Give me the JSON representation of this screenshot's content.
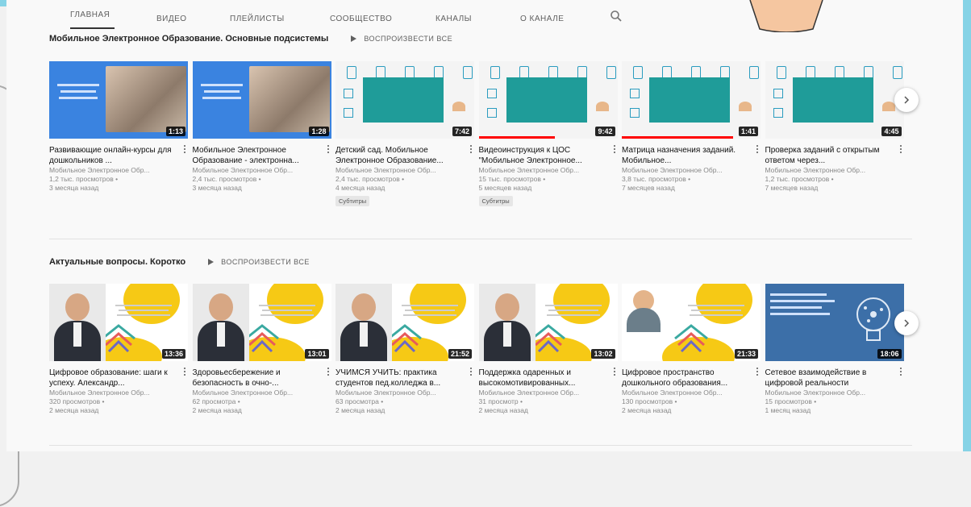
{
  "nav": {
    "tabs": [
      "ГЛАВНАЯ",
      "ВИДЕО",
      "ПЛЕЙЛИСТЫ",
      "СООБЩЕСТВО",
      "КАНАЛЫ",
      "О КАНАЛЕ"
    ],
    "active": "ГЛАВНАЯ"
  },
  "sections": [
    {
      "title": "Мобильное Электронное Образование. Основные подсистемы",
      "play_all": "ВОСПРОИЗВЕСТИ ВСЕ",
      "videos": [
        {
          "title": "Развивающие онлайн-курсы для дошкольников ...",
          "channel": "Мобильное Электронное Обр...",
          "views": "1,2 тыс. просмотров",
          "age": "3 месяца назад",
          "duration": "1:13",
          "thumb": "blue-photo"
        },
        {
          "title": "Мобильное Электронное Образование - электронна...",
          "channel": "Мобильное Электронное Обр...",
          "views": "2,4 тыс. просмотров",
          "age": "3 месяца назад",
          "duration": "1:28",
          "thumb": "blue-photo"
        },
        {
          "title": "Детский сад. Мобильное Электронное Образование...",
          "channel": "Мобильное Электронное Обр...",
          "views": "2,4 тыс. просмотров",
          "age": "4 месяца назад",
          "duration": "7:42",
          "badge": "Субтитры",
          "thumb": "teal"
        },
        {
          "title": "Видеоинструкция к ЦОС \"Мобильное Электронное...",
          "channel": "Мобильное Электронное Обр...",
          "views": "15 тыс. просмотров",
          "age": "5 месяцев назад",
          "duration": "9:42",
          "badge": "Субтитры",
          "progress": 0.55,
          "thumb": "teal"
        },
        {
          "title": "Матрица назначения заданий. Мобильное...",
          "channel": "Мобильное Электронное Обр...",
          "views": "3,8 тыс. просмотров",
          "age": "7 месяцев назад",
          "duration": "1:41",
          "progress": 0.8,
          "thumb": "teal"
        },
        {
          "title": "Проверка заданий с открытым ответом через...",
          "channel": "Мобильное Электронное Обр...",
          "views": "1,2 тыс. просмотров",
          "age": "7 месяцев назад",
          "duration": "4:45",
          "thumb": "teal"
        }
      ]
    },
    {
      "title": "Актуальные вопросы. Коротко",
      "play_all": "ВОСПРОИЗВЕСТИ ВСЕ",
      "videos": [
        {
          "title": "Цифровое образование: шаги к успеху. Александр...",
          "channel": "Мобильное Электронное Обр...",
          "views": "320 просмотров",
          "age": "2 месяца назад",
          "duration": "13:36",
          "thumb": "person"
        },
        {
          "title": "Здоровьесбережение и безопасность в очно-...",
          "channel": "Мобильное Электронное Обр...",
          "views": "62 просмотра",
          "age": "2 месяца назад",
          "duration": "13:01",
          "thumb": "person"
        },
        {
          "title": "УЧИМСЯ УЧИТЬ: практика студентов пед.колледжа в...",
          "channel": "Мобильное Электронное Обр...",
          "views": "63 просмотра",
          "age": "2 месяца назад",
          "duration": "21:52",
          "thumb": "person"
        },
        {
          "title": "Поддержка одаренных и высокомотивированных...",
          "channel": "Мобильное Электронное Обр...",
          "views": "31 просмотр",
          "age": "2 месяца назад",
          "duration": "13:02",
          "thumb": "person"
        },
        {
          "title": "Цифровое пространство дошкольного образования...",
          "channel": "Мобильное Электронное Обр...",
          "views": "130 просмотров",
          "age": "2 месяца назад",
          "duration": "21:33",
          "thumb": "person-woman"
        },
        {
          "title": "Сетевое взаимодействие в цифровой реальности",
          "channel": "Мобильное Электронное Обр...",
          "views": "15 просмотров",
          "age": "1 месяц назад",
          "duration": "18:06",
          "thumb": "network"
        }
      ]
    }
  ],
  "colors": {
    "accent": "#1f9c99",
    "yellow": "#f6c915",
    "blue": "#3a83e0",
    "frame": "#86d3e6"
  }
}
